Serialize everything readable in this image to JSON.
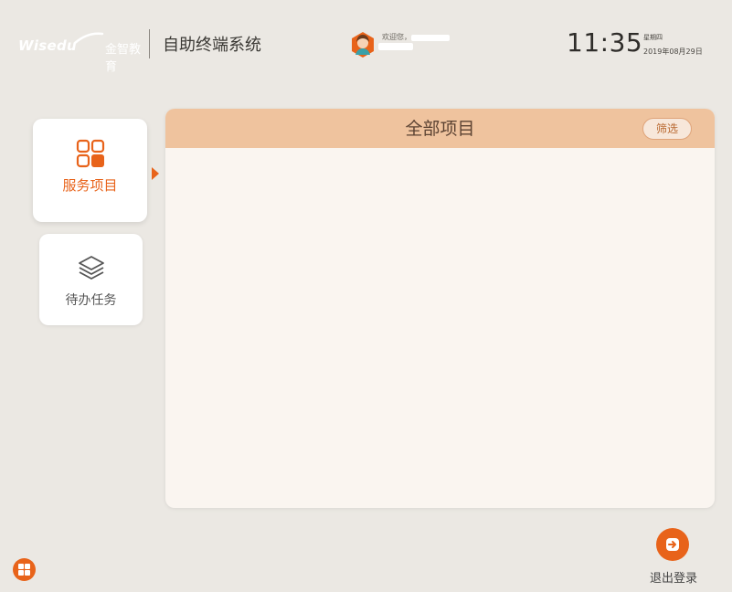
{
  "header": {
    "logo_brand": "Wisedu",
    "logo_cn": "金智教育",
    "system_title": "自助终端系统",
    "welcome": "欢迎您，",
    "time": "11:35",
    "weekday": "星期四",
    "date": "2019年08月29日"
  },
  "nav": {
    "items": [
      {
        "label": "服务项目",
        "icon": "grid-apps-icon",
        "active": true
      },
      {
        "label": "待办任务",
        "icon": "layers-icon",
        "active": false
      }
    ]
  },
  "panel": {
    "title": "全部项目",
    "filter_label": "筛选"
  },
  "footer": {
    "start_icon": "windows-icon",
    "logout_label": "退出登录"
  },
  "colors": {
    "accent": "#e8631a",
    "panel_header": "#efc39e",
    "panel_body": "#faf5f0",
    "background": "#ebe8e3"
  }
}
